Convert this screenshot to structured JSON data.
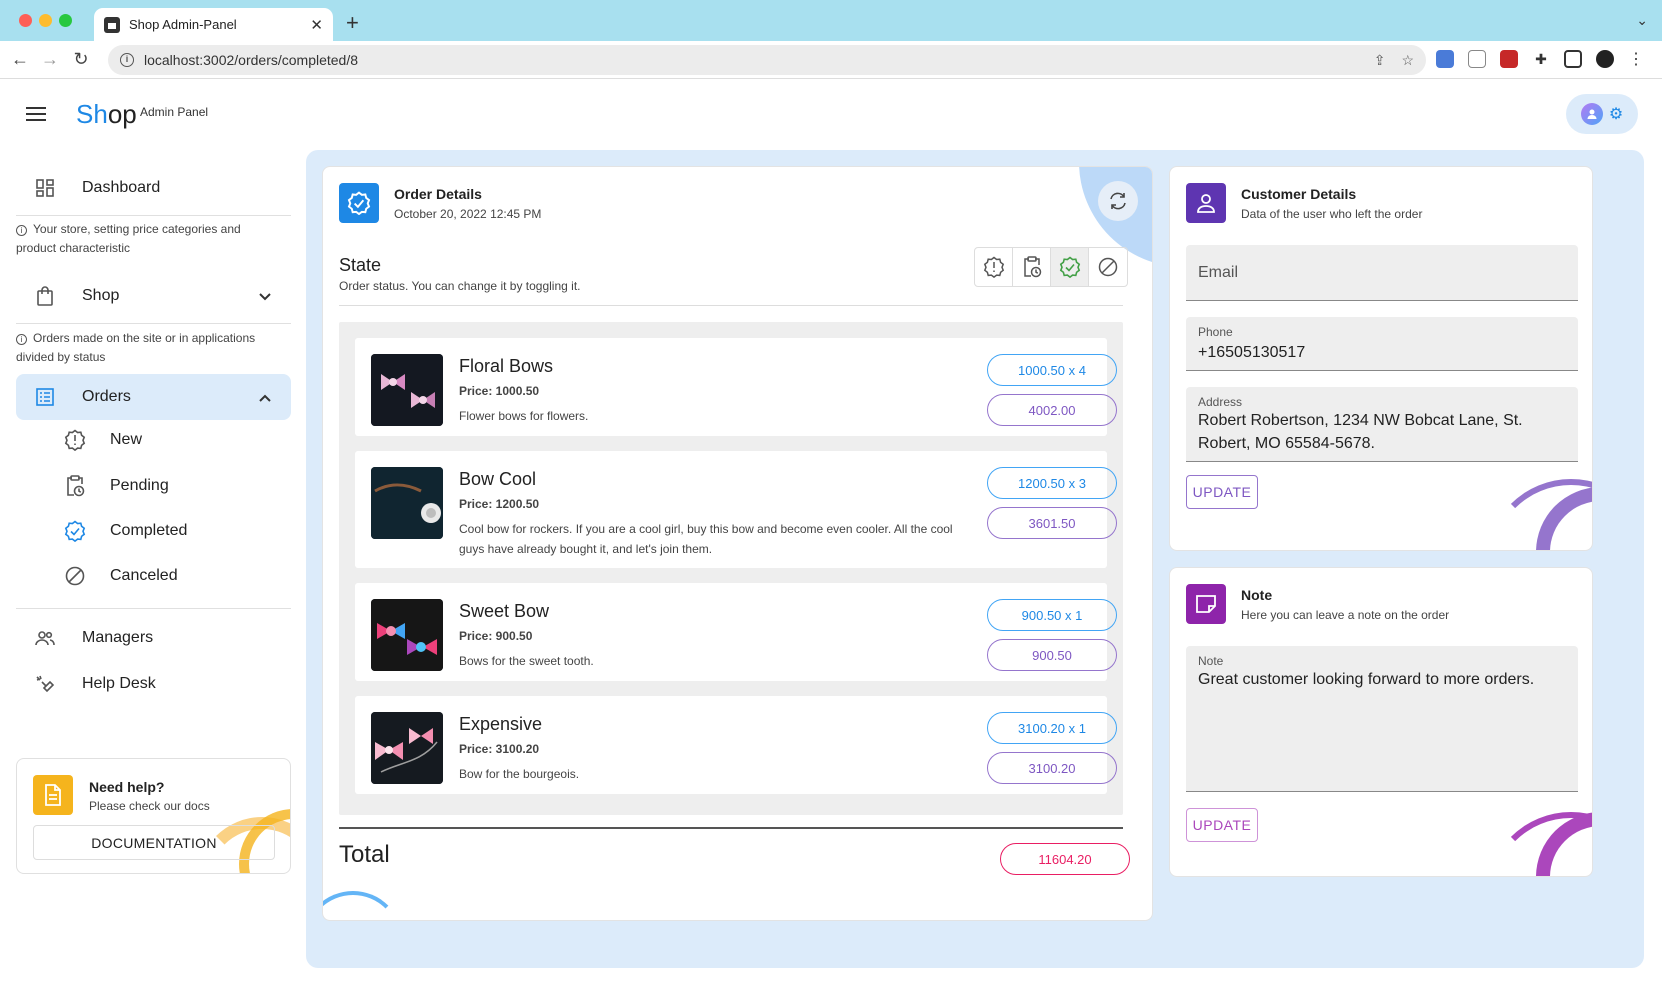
{
  "browser": {
    "tab_title": "Shop Admin-Panel",
    "url": "localhost:3002/orders/completed/8"
  },
  "header": {
    "logo_a": "Sh",
    "logo_b": "op",
    "subtitle": "Admin Panel"
  },
  "sidebar": {
    "dashboard": "Dashboard",
    "shop_hint": "Your store, setting price categories and product characteristic",
    "shop": "Shop",
    "orders_hint": "Orders made on the site or in applications divided by status",
    "orders": "Orders",
    "sub_items": [
      "New",
      "Pending",
      "Completed",
      "Canceled"
    ],
    "managers": "Managers",
    "help_desk": "Help Desk",
    "help": {
      "title": "Need help?",
      "subtitle": "Please check our docs",
      "button": "DOCUMENTATION"
    }
  },
  "order": {
    "title": "Order Details",
    "date": "October 20, 2022 12:45 PM",
    "state_title": "State",
    "state_sub": "Order status. You can change it by toggling it.",
    "items": [
      {
        "name": "Floral Bows",
        "price": "Price: 1000.50",
        "desc": "Flower bows for flowers.",
        "qty": "1000.50 x 4",
        "subtotal": "4002.00"
      },
      {
        "name": "Bow Cool",
        "price": "Price: 1200.50",
        "desc": "Cool bow for rockers. If you are a cool girl, buy this bow and become even cooler. All the cool guys have already bought it, and let's join them.",
        "qty": "1200.50 x 3",
        "subtotal": "3601.50"
      },
      {
        "name": "Sweet Bow",
        "price": "Price: 900.50",
        "desc": "Bows for the sweet tooth.",
        "qty": "900.50 x 1",
        "subtotal": "900.50"
      },
      {
        "name": "Expensive",
        "price": "Price: 3100.20",
        "desc": "Bow for the bourgeois.",
        "qty": "3100.20 x 1",
        "subtotal": "3100.20"
      }
    ],
    "total_label": "Total",
    "total": "11604.20"
  },
  "customer": {
    "title": "Customer Details",
    "subtitle": "Data of the user who left the order",
    "email_placeholder": "Email",
    "phone_label": "Phone",
    "phone": "+16505130517",
    "address_label": "Address",
    "address": "Robert Robertson, 1234 NW Bobcat Lane, St. Robert, MO 65584-5678.",
    "update": "UPDATE"
  },
  "note": {
    "title": "Note",
    "subtitle": "Here you can leave a note on the order",
    "label": "Note",
    "value": "Great customer looking forward to more orders.",
    "update": "UPDATE"
  },
  "colors": {
    "primary": "#1e88e5",
    "customer_icon": "#5e35b1",
    "note_icon": "#8e24aa",
    "help_icon": "#f5b41d",
    "total_chip": "#e91e63",
    "main_bg": "#dcebfa"
  },
  "icons": [
    "shop-favicon",
    "grid-icon",
    "bag-icon",
    "list-icon",
    "alert-icon",
    "clipboard-clock-icon",
    "verified-icon",
    "ban-icon",
    "managers-icon",
    "helpdesk-icon",
    "document-icon",
    "refresh-icon",
    "person-icon",
    "note-icon",
    "gear-icon"
  ]
}
